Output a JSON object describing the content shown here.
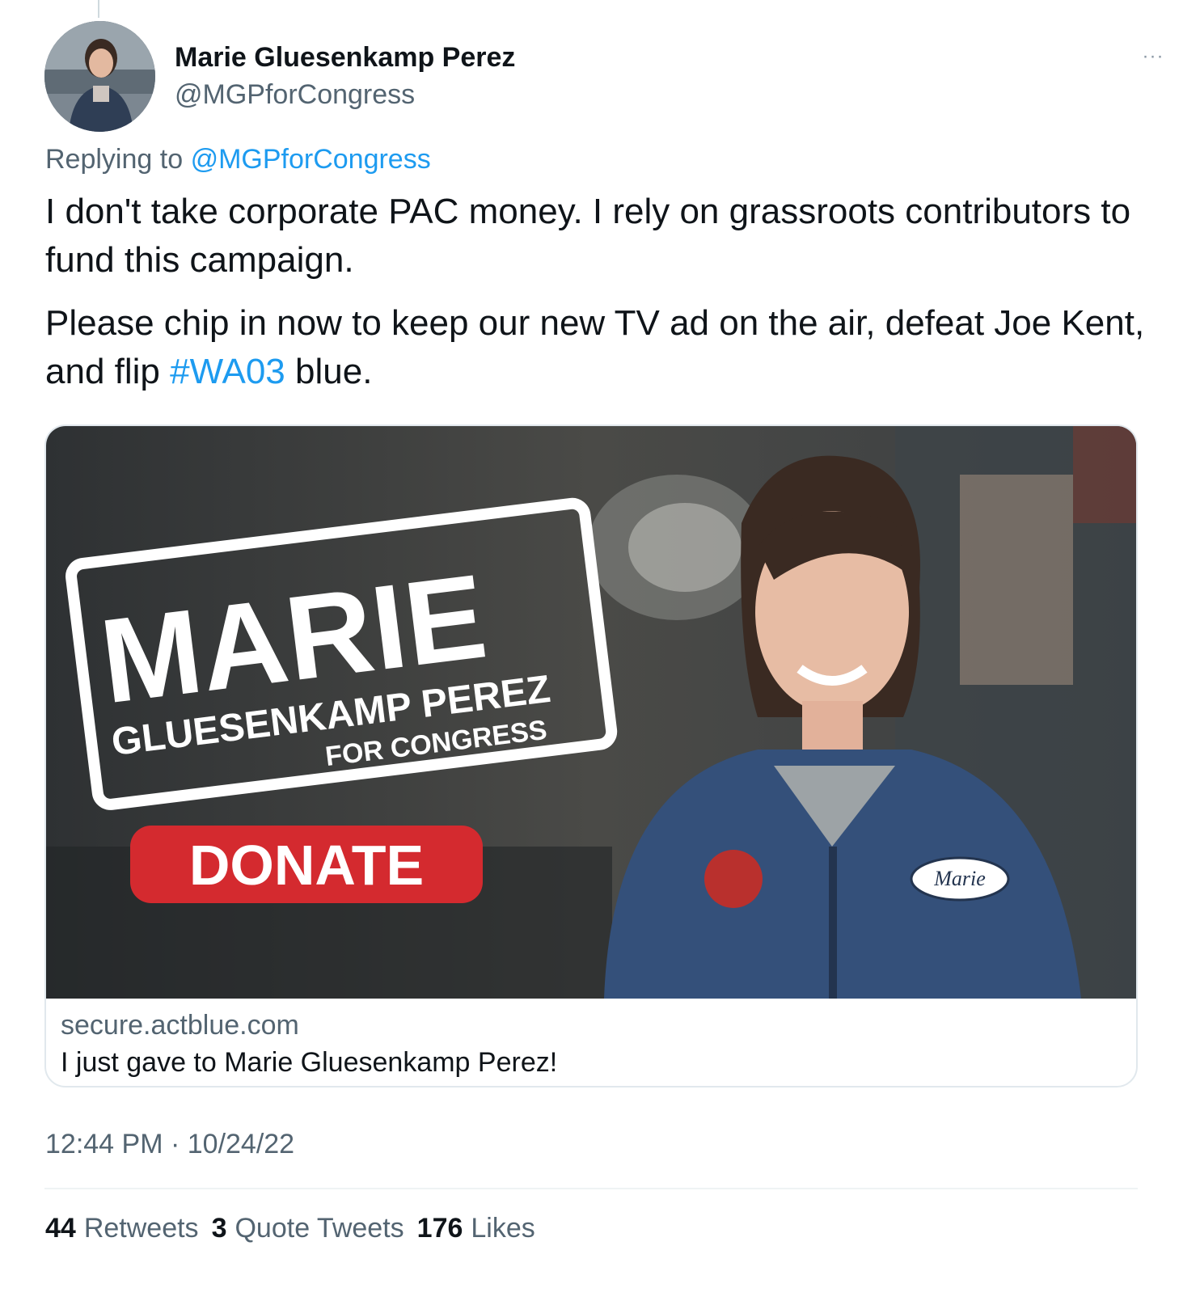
{
  "tweet": {
    "author_name": "Marie Gluesenkamp Perez",
    "author_handle": "@MGPforCongress",
    "more_label": "···",
    "replying_prefix": "Replying to",
    "replying_mention": "@MGPforCongress",
    "paragraph1": "I don't take corporate PAC money. I rely on grassroots contributors to fund this campaign.",
    "paragraph2_before": "Please chip in now to keep our new TV ad on the air, defeat Joe Kent, and flip",
    "paragraph2_hashtag": "#WA03",
    "paragraph2_after": "blue.",
    "timestamp": "12:44 PM · 10/24/22"
  },
  "card": {
    "image_text": {
      "name_big": "MARIE",
      "name_rest": "GLUESENKAMP PEREZ",
      "for_congress": "FOR CONGRESS",
      "donate": "DONATE",
      "name_patch": "Marie"
    },
    "domain": "secure.actblue.com",
    "title": "I just gave to Marie Gluesenkamp Perez!"
  },
  "stats": [
    {
      "count": "44",
      "label": "Retweets"
    },
    {
      "count": "3",
      "label": "Quote Tweets"
    },
    {
      "count": "176",
      "label": "Likes"
    }
  ],
  "colors": {
    "link": "#1d9bf0",
    "secondary_text": "#536471",
    "donate_red": "#d42a2f"
  }
}
